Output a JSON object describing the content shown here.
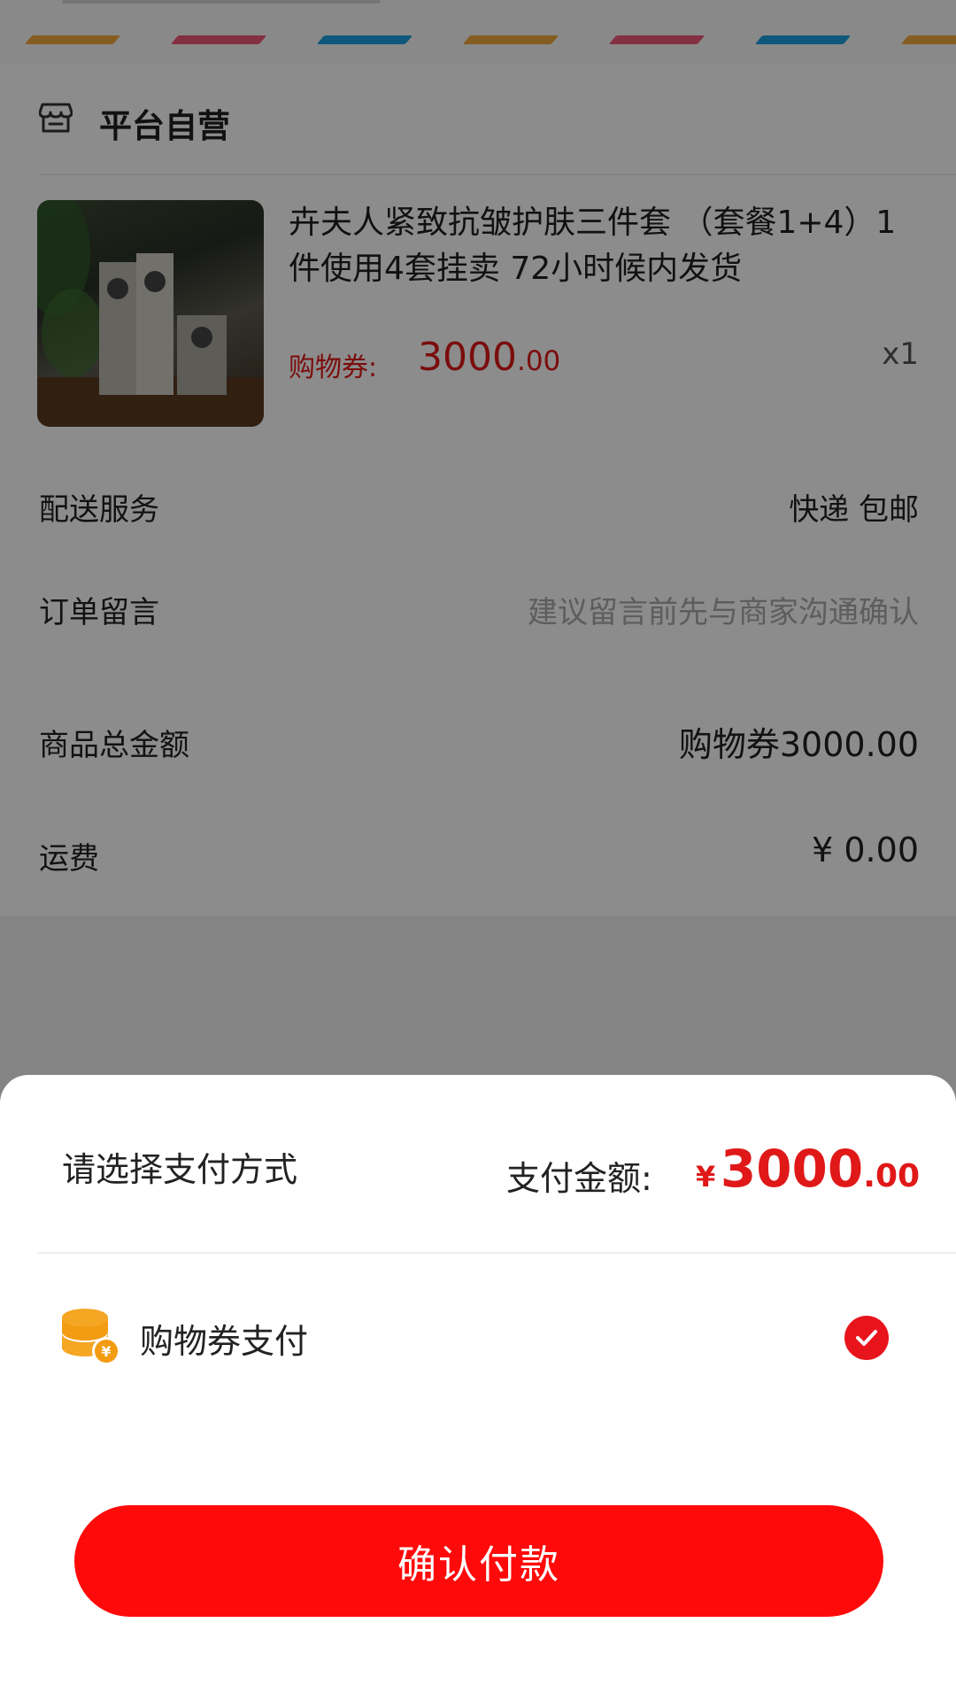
{
  "colors": {
    "accent_red": "#e01818",
    "button_red": "#ff0a0a",
    "coin_orange": "#f5a623",
    "stripe_colors": [
      "#f2a93b",
      "#f0587a",
      "#1ea0e0"
    ]
  },
  "store": {
    "icon": "store-icon",
    "name": "平台自营"
  },
  "product": {
    "image_icon": "product-photo",
    "title": "卉夫人紧致抗皱护肤三件套 （套餐1+4）1件使用4套挂卖 72小时候内发货",
    "price_label": "购物券:",
    "price_int": "3000",
    "price_dec": ".00",
    "quantity": "x1"
  },
  "delivery": {
    "label": "配送服务",
    "value": "快递 包邮"
  },
  "note": {
    "label": "订单留言",
    "placeholder": "建议留言前先与商家沟通确认"
  },
  "summary": {
    "total_label": "商品总金额",
    "total_value": "购物券3000.00",
    "shipping_label": "运费",
    "shipping_value": "¥ 0.00"
  },
  "payment_sheet": {
    "title": "请选择支付方式",
    "amount_label": "支付金额:",
    "amount_currency": "¥",
    "amount_int": "3000",
    "amount_dec": ".00",
    "method": {
      "icon": "coin-stack-icon",
      "label": "购物券支付",
      "selected": true
    },
    "confirm_label": "确认付款"
  }
}
